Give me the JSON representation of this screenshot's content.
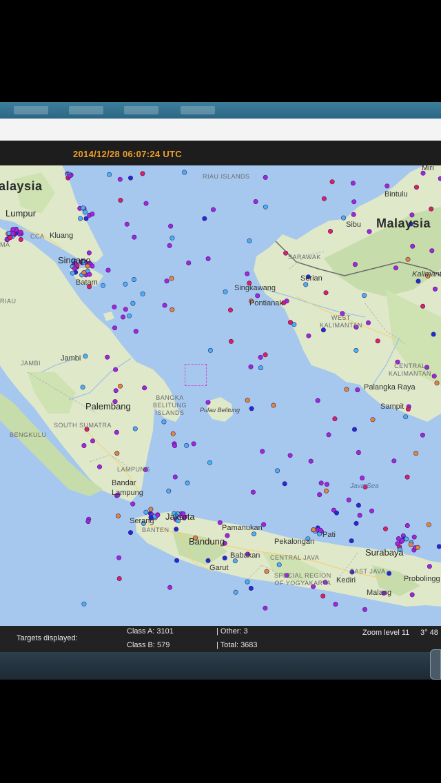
{
  "header": {
    "timestamp": "2014/12/28 06:07:24 UTC"
  },
  "map": {
    "labels": {
      "malaysia_west": "alaysia",
      "lumpur": "Lumpur",
      "kluang": "Kluang",
      "singapore": "Singapo",
      "batam": "Batam",
      "riau_islands": "RIAU ISLANDS",
      "riau": "RIAU",
      "jambi_prov": "JAMBI",
      "jambi": "Jambi",
      "palembang": "Palembang",
      "bangka_belitung": "BANGKA\nBELITUNG\nISLANDS",
      "pulau_belitung": "Pulau Belitung",
      "south_sumatra": "SOUTH SUMATRA",
      "bengkulu": "BENGKULU",
      "lampung": "LAMPUNG",
      "bandar_lampung": "Bandar\nLampung",
      "serang": "Serang",
      "banten": "BANTEN",
      "jakarta": "Jakarta",
      "pamanukan": "Pamanukan",
      "bandung": "Bandung",
      "babakan": "Babakan",
      "garut": "Garut",
      "pekalongan": "Pekalongan",
      "central_java": "CENTRAL JAVA",
      "yogyakarta": "SPECIAL REGION\nOF YOGYAKARTA",
      "pati": "Pati",
      "east_java": "EAST JAVA",
      "kediri": "Kediri",
      "malang": "Malang",
      "surabaya": "Surabaya",
      "probolinggo": "Probolingg",
      "java_sea": "Java Sea",
      "malaysia_east": "Malaysia",
      "miri": "Miri",
      "bintulu": "Bintulu",
      "sibu": "Sibu",
      "sarawak": "SARAWAK",
      "serian": "Serian",
      "kalimantan": "Kalimant",
      "singkawang": "Singkawang",
      "pontianak": "Pontianak",
      "west_kalimantan": "WEST\nKALIMANTAN",
      "central_kalimantan": "CENTRAL\nKALIMANTAN",
      "palangka_raya": "Palangka Raya",
      "sampit": "Sampit",
      "ma": "ma",
      "melaka": "CCA"
    },
    "legend_colors": {
      "class_a": "#a026e0",
      "class_b": "#3fb8f0",
      "tanker": "#e0205a",
      "cargo_blue": "#1a2ed8",
      "other": "#e08a30"
    }
  },
  "status": {
    "targets_label": "Targets displayed:",
    "class_a": "Class A: 3101",
    "class_b": "Class B: 579",
    "other": "| Other: 3",
    "total": "| Total: 3683",
    "zoom": "Zoom level 11",
    "coord": "3° 48"
  }
}
